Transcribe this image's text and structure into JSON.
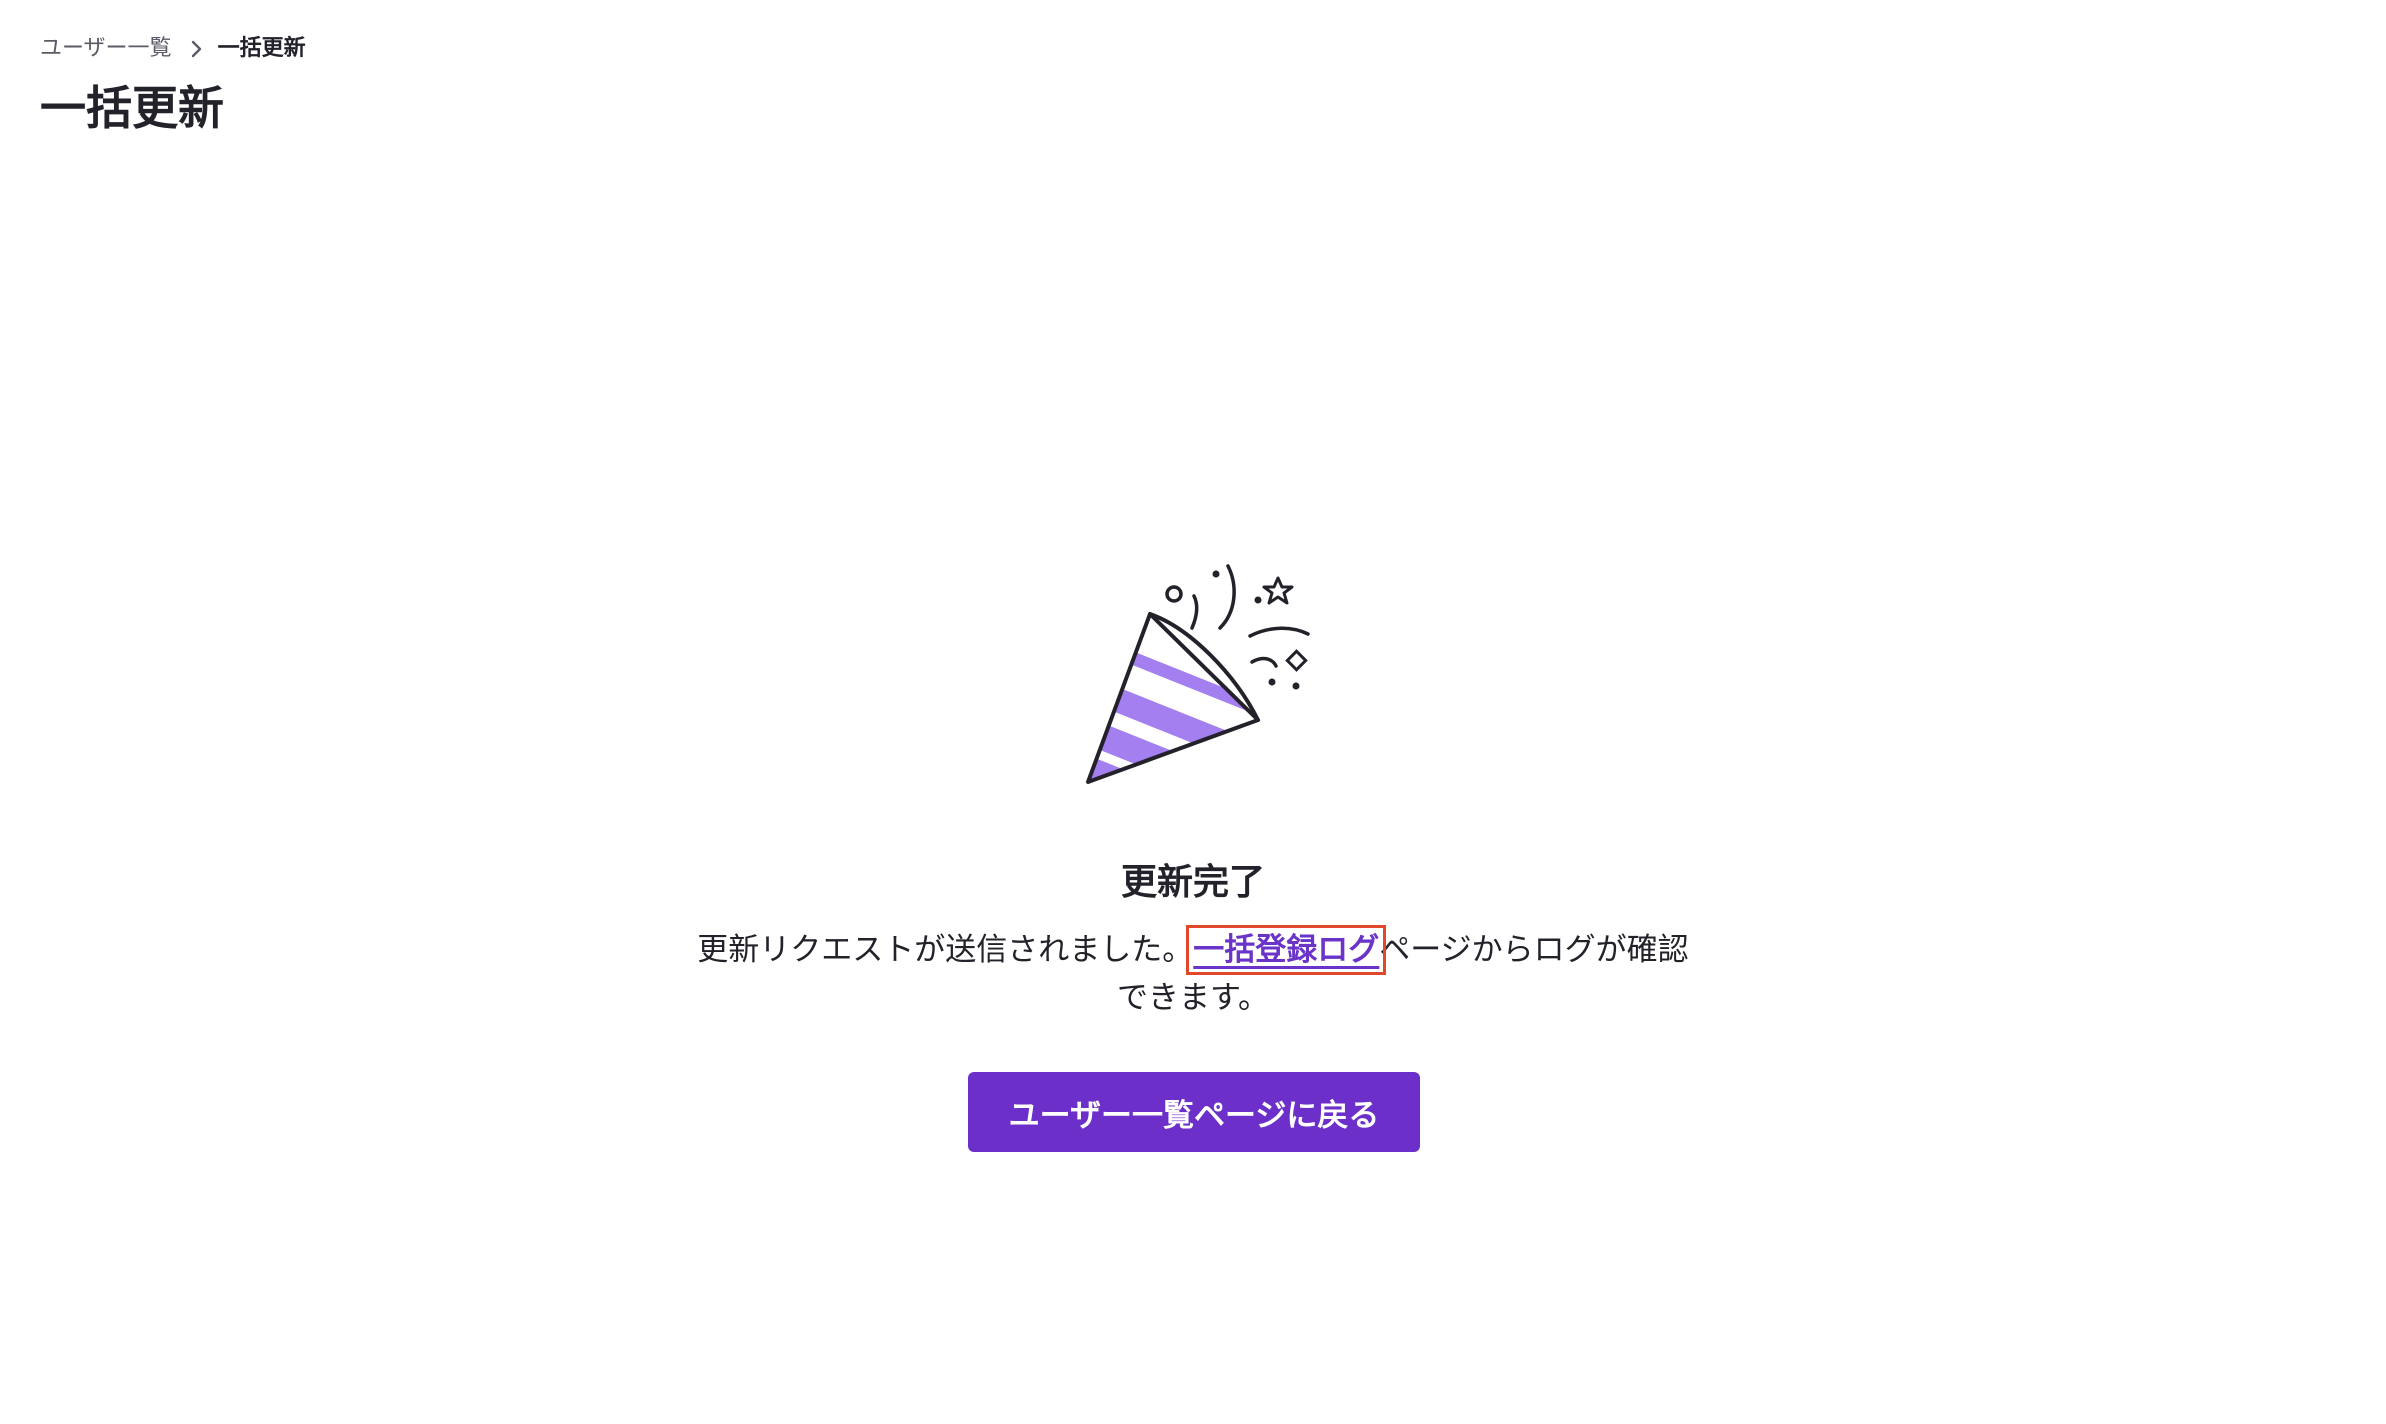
{
  "breadcrumb": {
    "parent_label": "ユーザー一覧",
    "current_label": "一括更新"
  },
  "page": {
    "title": "一括更新"
  },
  "completion": {
    "title": "更新完了",
    "message_before": "更新リクエストが送信されました。",
    "link_label": "一括登録ログ",
    "message_after": "ページからログが確認できます。",
    "button_label": "ユーザー一覧ページに戻る",
    "illustration_icon": "party-popper-icon"
  },
  "colors": {
    "accent": "#6c2fc9",
    "link": "#6a34c8",
    "highlight_outline": "#e0472b",
    "stripe": "#a47ff0",
    "text": "#23222a"
  }
}
